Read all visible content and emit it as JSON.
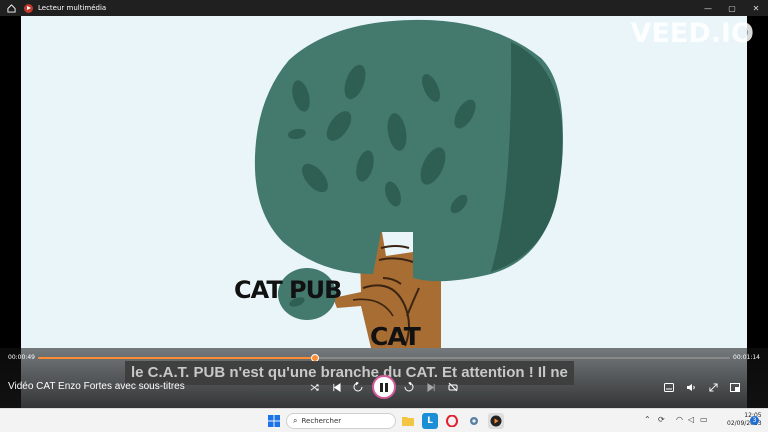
{
  "window": {
    "title": "Lecteur multimédia",
    "controls": {
      "minimize": "—",
      "maximize": "▢",
      "close": "✕"
    }
  },
  "video": {
    "watermark": "VEED.IO",
    "label_catpub": "CAT PUB",
    "label_cat": "CAT",
    "subtitle": "le C.A.T. PUB n'est qu'une branche du CAT. Et attention ! Il ne"
  },
  "player": {
    "video_title": "Vidéo CAT Enzo Fortes avec sous-titres",
    "time_current": "00:00:49",
    "time_total": "00:01:14",
    "progress_fraction": 0.4,
    "accent_color": "#ff8c33"
  },
  "taskbar": {
    "search_placeholder": "Rechercher",
    "clock_time": "12:05",
    "clock_date": "02/09/2023",
    "notification_count": "3"
  }
}
